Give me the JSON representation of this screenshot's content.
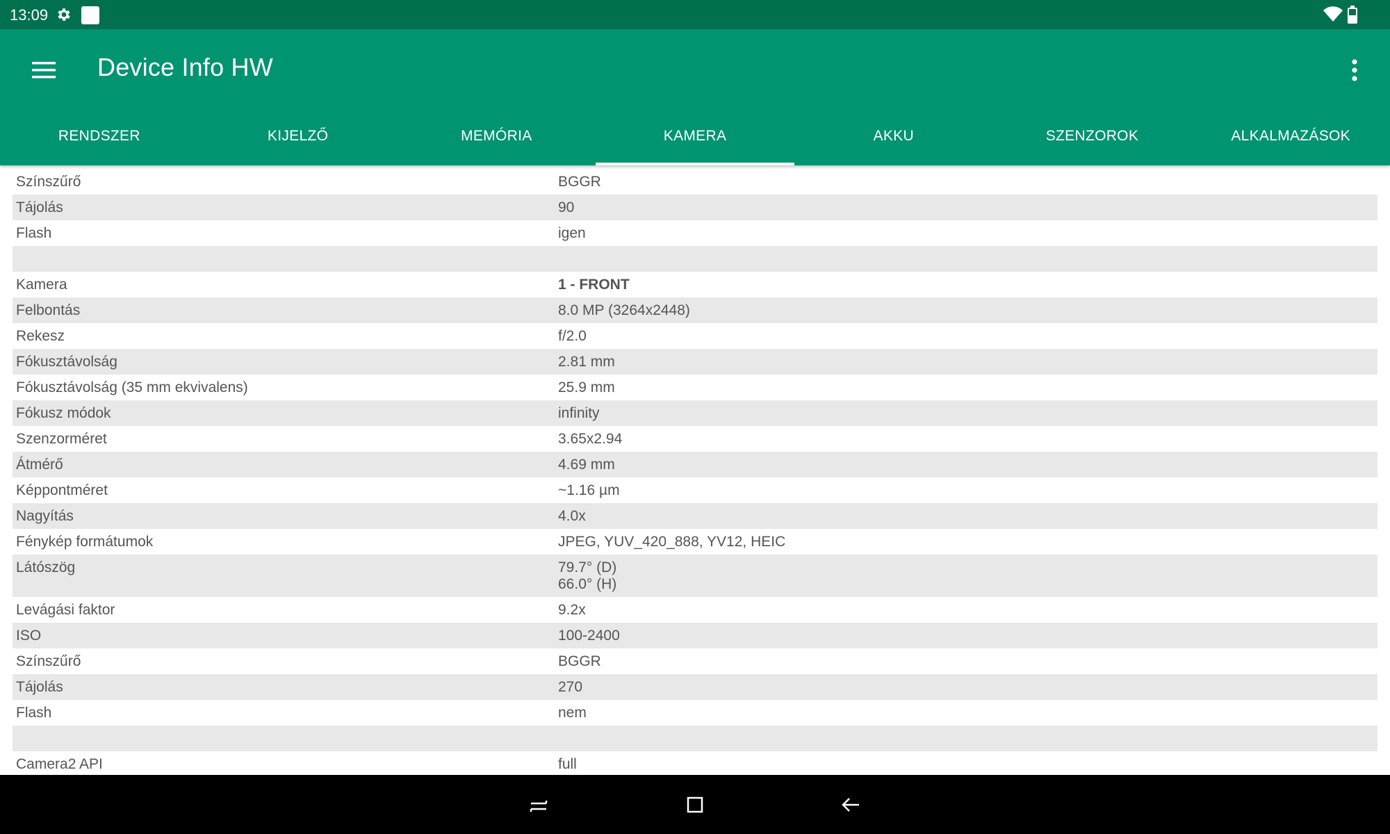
{
  "status_bar": {
    "time": "13:09",
    "icons": [
      "gear-icon",
      "notification-square-icon",
      "wifi-icon",
      "battery-icon"
    ]
  },
  "app_bar": {
    "title": "Device Info HW",
    "color": "#009470",
    "status_color": "#00704f"
  },
  "tabs": [
    {
      "label": "RENDSZER",
      "active": false
    },
    {
      "label": "KIJELZŐ",
      "active": false
    },
    {
      "label": "MEMÓRIA",
      "active": false
    },
    {
      "label": "KAMERA",
      "active": true
    },
    {
      "label": "AKKU",
      "active": false
    },
    {
      "label": "SZENZOROK",
      "active": false
    },
    {
      "label": "ALKALMAZÁSOK",
      "active": false
    }
  ],
  "rows": [
    {
      "key": "Színszűrő",
      "value": "BGGR"
    },
    {
      "key": "Tájolás",
      "value": "90"
    },
    {
      "key": "Flash",
      "value": "igen"
    },
    {
      "key": "",
      "value": ""
    },
    {
      "key": "Kamera",
      "value": "1 - FRONT"
    },
    {
      "key": "Felbontás",
      "value": "8.0 MP (3264x2448)"
    },
    {
      "key": "Rekesz",
      "value": "f/2.0"
    },
    {
      "key": "Fókusztávolság",
      "value": "2.81 mm"
    },
    {
      "key": "Fókusztávolság (35 mm ekvivalens)",
      "value": "25.9 mm"
    },
    {
      "key": "Fókusz módok",
      "value": "infinity"
    },
    {
      "key": "Szenzorméret",
      "value": "3.65x2.94"
    },
    {
      "key": "Átmérő",
      "value": "4.69 mm"
    },
    {
      "key": "Képpontméret",
      "value": "~1.16 µm"
    },
    {
      "key": "Nagyítás",
      "value": "4.0x"
    },
    {
      "key": "Fénykép formátumok",
      "value": "JPEG, YUV_420_888, YV12, HEIC"
    },
    {
      "key": "Látószög",
      "value": "79.7° (D)",
      "value2": "66.0° (H)"
    },
    {
      "key": "Levágási faktor",
      "value": "9.2x"
    },
    {
      "key": "ISO",
      "value": "100-2400"
    },
    {
      "key": "Színszűrő",
      "value": "BGGR"
    },
    {
      "key": "Tájolás",
      "value": "270"
    },
    {
      "key": "Flash",
      "value": "nem"
    },
    {
      "key": "",
      "value": ""
    },
    {
      "key": "Camera2 API",
      "value": "full"
    }
  ],
  "nav_bar": {
    "icons": [
      "recent-apps-icon",
      "home-icon",
      "back-icon"
    ]
  }
}
